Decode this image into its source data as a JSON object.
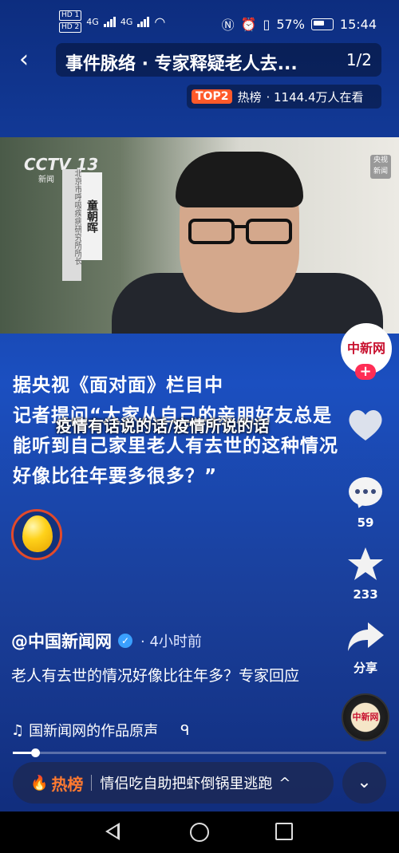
{
  "status_bar": {
    "signal1": "4G",
    "signal2": "4G",
    "hd1": "HD 1",
    "hd2": "HD 2",
    "battery": "57%",
    "time": "15:44"
  },
  "header": {
    "back_icon": "back-arrow-icon",
    "title": "事件脉络 · 专家释疑老人去...",
    "page_count": "1/2",
    "rank_badge": "TOP2",
    "rank_label": "热榜",
    "viewers": "· 1144.4万人在看"
  },
  "video": {
    "channel_logo": "CCTV 13",
    "channel_sub": "新闻",
    "guest_name": "童朝晖",
    "guest_title": "北京市呼吸疾病研究所所长",
    "corner_logo": "央视新闻"
  },
  "caption_lines": [
    "据央视《面对面》栏目中",
    "记者提问“大家从自己的亲朋好友总是",
    "能听到自己家里老人有去世的这种情况",
    "好像比往年要多很多？”"
  ],
  "overlay_title": "疫情有话说的话/疫情所说的话",
  "right_rail": {
    "avatar_text": "中新网",
    "follow_symbol": "+",
    "like_icon": "heart-icon",
    "comment_count": "59",
    "favorite_count": "233",
    "share_label": "分享"
  },
  "post": {
    "author": "@中国新闻网",
    "time": "· 4小时前",
    "description": "老人有去世的情况好像比往年多？专家回应",
    "music": "国新闻网的作品原声",
    "music_extra": "ᑫ",
    "disc_text": "中新网"
  },
  "progress": {
    "fraction": 0.06
  },
  "hot_bar": {
    "label": "热榜",
    "topic": "情侣吃自助把虾倒锅里逃跑",
    "chevron": "^",
    "collapse": "⌄"
  },
  "colors": {
    "background": "#1b4fc0",
    "accent": "#ff5a2a",
    "follow": "#ff2d55"
  }
}
